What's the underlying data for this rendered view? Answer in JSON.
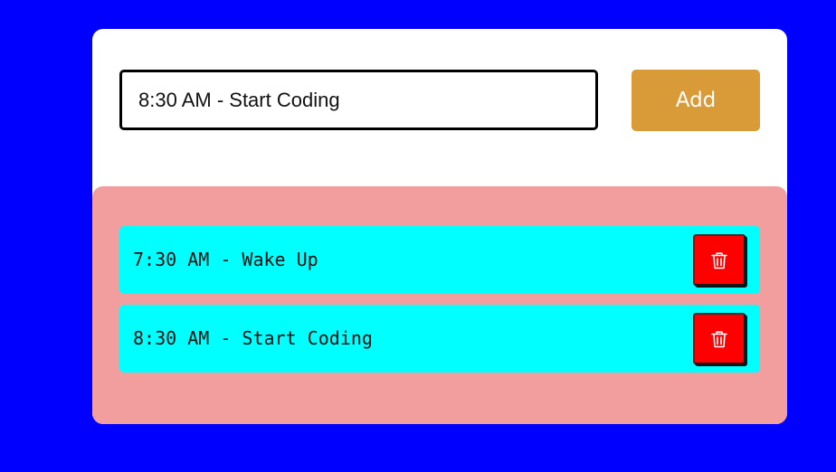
{
  "form": {
    "input_value": "8:30 AM - Start Coding",
    "add_label": "Add"
  },
  "tasks": [
    {
      "text": "7:30 AM - Wake Up",
      "delete_icon": "trash-icon"
    },
    {
      "text": "8:30 AM - Start Coding",
      "delete_icon": "trash-icon"
    }
  ],
  "colors": {
    "page_background": "#0000ff",
    "card_background": "#ffffff",
    "list_background": "#f39e9e",
    "task_background": "#00ffff",
    "add_button": "#d99a38",
    "delete_button": "#ff0000"
  }
}
